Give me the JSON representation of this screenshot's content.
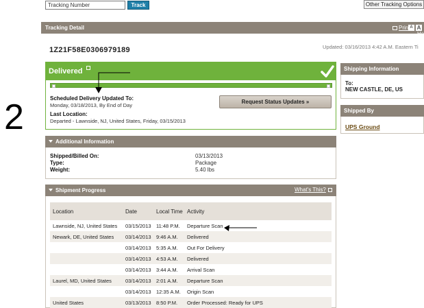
{
  "search": {
    "value": "Tracking Number",
    "track_label": "Track",
    "other_options_label": "Other Tracking Options"
  },
  "annotation_number": "2",
  "detail": {
    "title": "Tracking Detail",
    "print_label": "Print",
    "help_label": "Help",
    "font_small": "A",
    "font_large": "A"
  },
  "tracking_number": "1Z21F58E0306979189",
  "updated_text": "Updated: 03/16/2013 4:42 A.M. Eastern Ti",
  "status": {
    "title": "Delivered",
    "progress_percent": 100,
    "scheduled_label": "Scheduled Delivery Updated To:",
    "scheduled_value": "Monday, 03/18/2013, By End of Day",
    "last_location_label": "Last Location:",
    "last_location_value": "Departed - Lawnside, NJ, United States, Friday, 03/15/2013",
    "request_button": "Request Status Updates »"
  },
  "additional": {
    "title": "Additional Information",
    "rows": [
      {
        "label": "Shipped/Billed On:",
        "value": "03/13/2013"
      },
      {
        "label": "Type:",
        "value": "Package"
      },
      {
        "label": "Weight:",
        "value": "5.40 lbs"
      }
    ]
  },
  "progress_section": {
    "title": "Shipment Progress",
    "whats_this": "What's This?",
    "headers": [
      "Location",
      "Date",
      "Local Time",
      "Activity"
    ],
    "rows": [
      {
        "location": "Lawnside, NJ, United States",
        "date": "03/15/2013",
        "time": "11:48 P.M.",
        "activity": "Departure Scan"
      },
      {
        "location": "Newark, DE, United States",
        "date": "03/14/2013",
        "time": "9:46 A.M.",
        "activity": "Delivered"
      },
      {
        "location": "",
        "date": "03/14/2013",
        "time": "5:35 A.M.",
        "activity": "Out For Delivery"
      },
      {
        "location": "",
        "date": "03/14/2013",
        "time": "4:53 A.M.",
        "activity": "Delivered"
      },
      {
        "location": "",
        "date": "03/14/2013",
        "time": "3:44 A.M.",
        "activity": "Arrival Scan"
      },
      {
        "location": "Laurel, MD, United States",
        "date": "03/14/2013",
        "time": "2:01 A.M.",
        "activity": "Departure Scan"
      },
      {
        "location": "",
        "date": "03/14/2013",
        "time": "12:35 A.M.",
        "activity": "Origin Scan"
      },
      {
        "location": "United States",
        "date": "03/13/2013",
        "time": "8:50 P.M.",
        "activity": "Order Processed: Ready for UPS"
      }
    ]
  },
  "shipping_info": {
    "title": "Shipping Information",
    "to_label": "To:",
    "to_value": "NEW CASTLE, DE, US"
  },
  "shipped_by": {
    "title": "Shipped By",
    "carrier": "UPS Ground"
  },
  "colors": {
    "green": "#6fb23c",
    "taupe": "#8c8378",
    "link_brown": "#6a4a12",
    "button_blue": "#1f7fa8"
  }
}
